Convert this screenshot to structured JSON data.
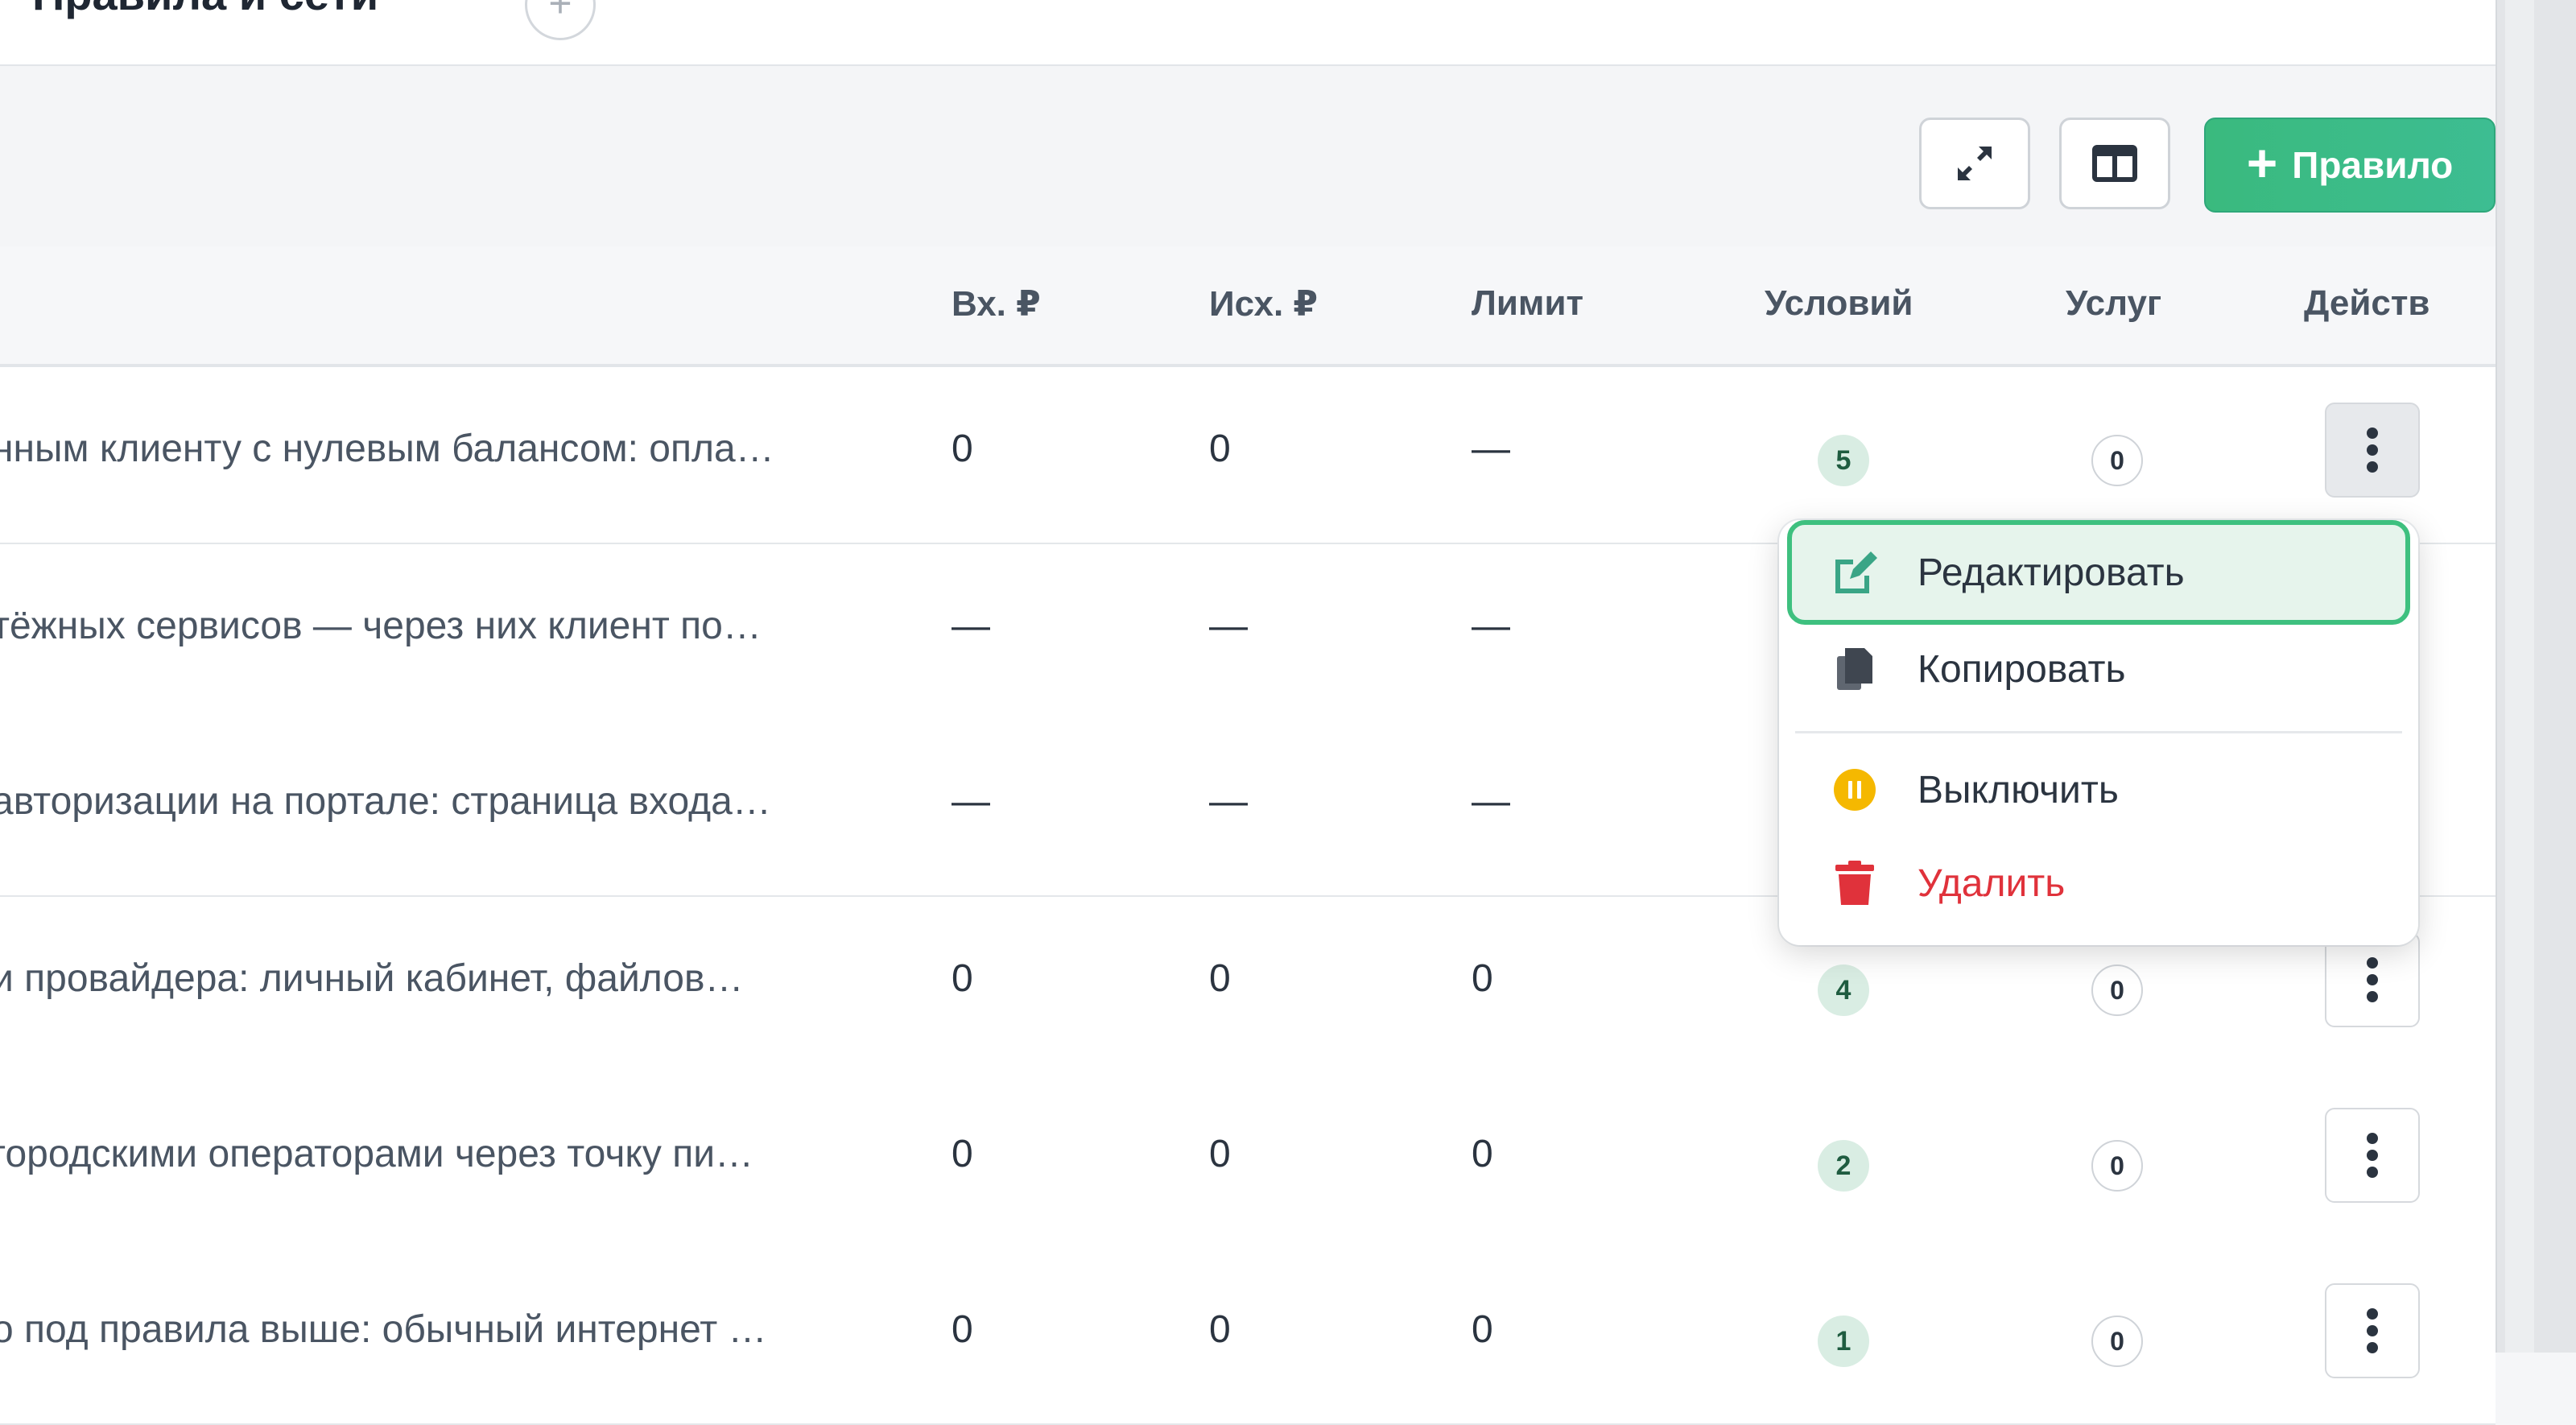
{
  "header": {
    "title": "Правила и сети",
    "title_plus": "+"
  },
  "toolbar": {
    "add_rule_label": "Правило",
    "add_rule_plus": "+"
  },
  "table": {
    "columns": [
      "Вх. ₽",
      "Исх. ₽",
      "Лимит",
      "Условий",
      "Услуг",
      "Действ"
    ],
    "rows": [
      {
        "name": "нным клиенту с нулевым балансом: опла…",
        "in": "0",
        "out": "0",
        "limit": "—",
        "conditions": "5",
        "services": "0"
      },
      {
        "name": "тёжных сервисов — через них клиент по…",
        "in": "—",
        "out": "—",
        "limit": "—",
        "conditions": "",
        "services": ""
      },
      {
        "name": "авторизации на портале: страница входа…",
        "in": "—",
        "out": "—",
        "limit": "—",
        "conditions": "",
        "services": ""
      },
      {
        "name": "и провайдера: личный кабинет, файлов…",
        "in": "0",
        "out": "0",
        "limit": "0",
        "conditions": "4",
        "services": "0"
      },
      {
        "name": "городскими операторами через точку пи…",
        "in": "0",
        "out": "0",
        "limit": "0",
        "conditions": "2",
        "services": "0"
      },
      {
        "name": "о под правила выше: обычный интернет …",
        "in": "0",
        "out": "0",
        "limit": "0",
        "conditions": "1",
        "services": "0"
      }
    ]
  },
  "menu": {
    "edit": "Редактировать",
    "copy": "Копировать",
    "disable": "Выключить",
    "delete": "Удалить"
  },
  "icons": {
    "expand": "expand-arrows-icon",
    "columns": "columns-layout-icon",
    "edit": "pencil-square-icon",
    "copy": "copy-files-icon",
    "disable": "pause-circle-icon",
    "delete": "trash-icon",
    "kebab": "vertical-dots-icon"
  },
  "colors": {
    "accent": "#3aba7e",
    "danger": "#e0323b",
    "warning": "#f5b800",
    "badge_green": "#d9ede3"
  }
}
